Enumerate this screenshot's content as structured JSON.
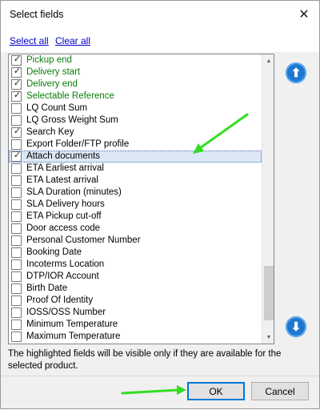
{
  "dialog": {
    "title": "Select fields",
    "close_glyph": "✕"
  },
  "toolbar": {
    "select_all": "Select all",
    "clear_all": "Clear all"
  },
  "fields": [
    {
      "label": "Pickup end",
      "checked": true,
      "green": true
    },
    {
      "label": "Delivery start",
      "checked": true,
      "green": true
    },
    {
      "label": "Delivery end",
      "checked": true,
      "green": true
    },
    {
      "label": "Selectable Reference",
      "checked": true,
      "green": true
    },
    {
      "label": "LQ Count Sum",
      "checked": false,
      "green": false
    },
    {
      "label": "LQ Gross Weight Sum",
      "checked": false,
      "green": false
    },
    {
      "label": "Search Key",
      "checked": true,
      "green": false
    },
    {
      "label": "Export Folder/FTP profile",
      "checked": false,
      "green": false
    },
    {
      "label": "Attach documents",
      "checked": true,
      "green": false,
      "selected": true
    },
    {
      "label": "ETA Earliest arrival",
      "checked": false,
      "green": false
    },
    {
      "label": "ETA Latest arrival",
      "checked": false,
      "green": false
    },
    {
      "label": "SLA Duration (minutes)",
      "checked": false,
      "green": false
    },
    {
      "label": "SLA Delivery hours",
      "checked": false,
      "green": false
    },
    {
      "label": "ETA Pickup cut-off",
      "checked": false,
      "green": false
    },
    {
      "label": "Door access code",
      "checked": false,
      "green": false
    },
    {
      "label": "Personal Customer Number",
      "checked": false,
      "green": false
    },
    {
      "label": "Booking Date",
      "checked": false,
      "green": false
    },
    {
      "label": "Incoterms Location",
      "checked": false,
      "green": false
    },
    {
      "label": "DTP/IOR Account",
      "checked": false,
      "green": false
    },
    {
      "label": "Birth Date",
      "checked": false,
      "green": false
    },
    {
      "label": "Proof Of Identity",
      "checked": false,
      "green": false
    },
    {
      "label": "IOSS/OSS Number",
      "checked": false,
      "green": false
    },
    {
      "label": "Minimum Temperature",
      "checked": false,
      "green": false
    },
    {
      "label": "Maximum Temperature",
      "checked": false,
      "green": false
    }
  ],
  "scrollbar": {
    "up_glyph": "▲",
    "down_glyph": "▼",
    "position": 0.95
  },
  "move_buttons": {
    "up_glyph": "⬆",
    "down_glyph": "⬇"
  },
  "note": "The highlighted fields will be visible only if they are available for the selected product.",
  "buttons": {
    "ok": "OK",
    "cancel": "Cancel"
  },
  "colors": {
    "highlight_text": "#0a7d0a",
    "link": "#0000cc",
    "annotation_arrow": "#33dd22",
    "accent": "#0078d7"
  }
}
